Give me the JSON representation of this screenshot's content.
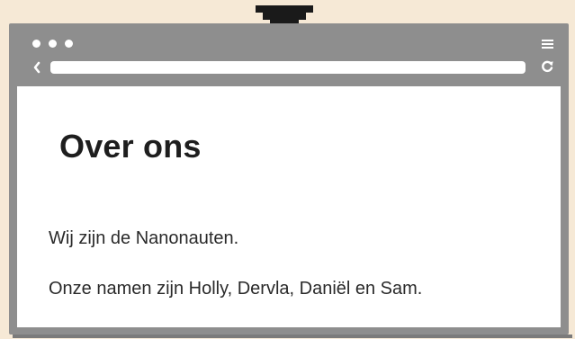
{
  "browser": {
    "window_dots": [
      "dot",
      "dot",
      "dot"
    ],
    "address_value": "",
    "icons": {
      "pointer": "down-arrow-pointer-icon",
      "back": "chevron-left-icon",
      "menu": "hamburger-menu-icon",
      "reload": "reload-icon"
    }
  },
  "page": {
    "title": "Over ons",
    "paragraphs": [
      "Wij zijn de Nanonauten.",
      "Onze namen zijn Holly, Dervla, Daniël en Sam."
    ]
  },
  "colors": {
    "background": "#f6e9d6",
    "frame": "#8e8e8e",
    "content": "#ffffff",
    "text": "#1e1e1e",
    "pointer": "#1a1a1a"
  }
}
